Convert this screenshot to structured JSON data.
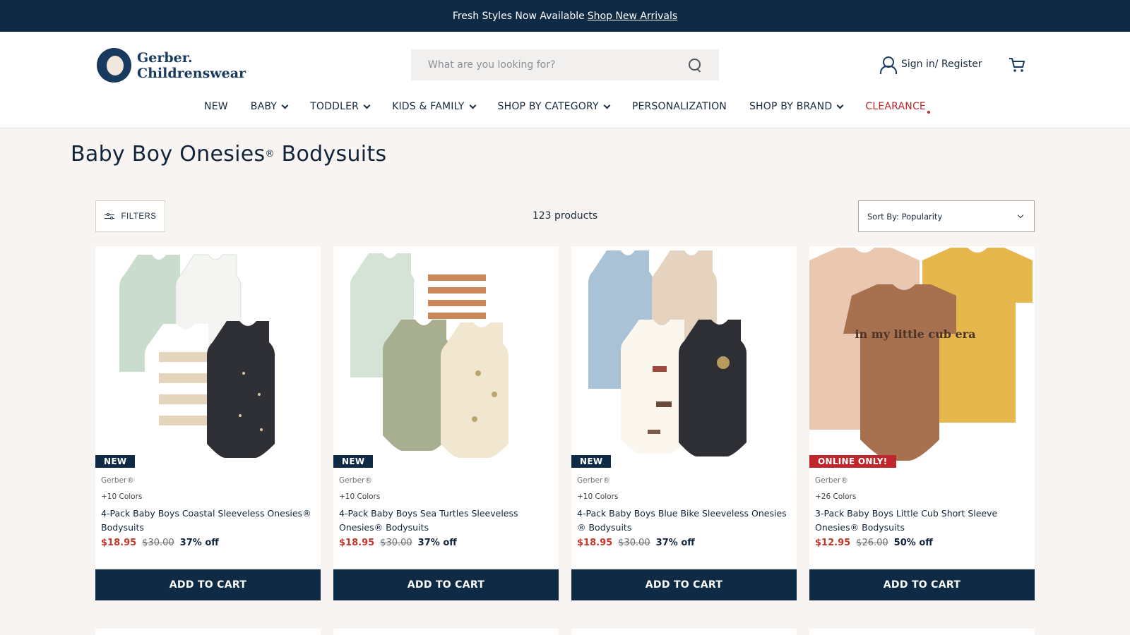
{
  "promo": {
    "text": "Fresh Styles Now Available",
    "link": "Shop New Arrivals"
  },
  "header": {
    "logo_line1": "Gerber.",
    "logo_line2": "Childrenswear",
    "search_placeholder": "What are you looking for?",
    "account_label": "Sign in/ Register"
  },
  "nav": [
    {
      "label": "NEW",
      "has_menu": false
    },
    {
      "label": "BABY",
      "has_menu": true
    },
    {
      "label": "TODDLER",
      "has_menu": true
    },
    {
      "label": "KIDS & FAMILY",
      "has_menu": true
    },
    {
      "label": "SHOP BY CATEGORY",
      "has_menu": true
    },
    {
      "label": "PERSONALIZATION",
      "has_menu": false
    },
    {
      "label": "SHOP BY BRAND",
      "has_menu": true
    },
    {
      "label": "CLEARANCE",
      "has_menu": false
    }
  ],
  "page": {
    "title_part1": "Baby Boy Onesies",
    "title_reg": "®",
    "title_part2": " Bodysuits",
    "filters_label": "FILTERS",
    "product_count": "123 products",
    "sort_label": "Sort By: Popularity"
  },
  "products": [
    {
      "badge": "NEW",
      "brand": "Gerber®",
      "colors": "+10 Colors",
      "name": "4-Pack Baby Boys Coastal Sleeveless Onesies® Bodysuits",
      "price": "$18.95",
      "old_price": "$30.00",
      "off": "37% off",
      "cta": "ADD TO CART"
    },
    {
      "badge": "NEW",
      "brand": "Gerber®",
      "colors": "+10 Colors",
      "name": "4-Pack Baby Boys Sea Turtles Sleeveless Onesies® Bodysuits",
      "price": "$18.95",
      "old_price": "$30.00",
      "off": "37% off",
      "cta": "ADD TO CART"
    },
    {
      "badge": "NEW",
      "brand": "Gerber®",
      "colors": "+10 Colors",
      "name": "4-Pack Baby Boys Blue Bike Sleeveless Onesies ® Bodysuits",
      "price": "$18.95",
      "old_price": "$30.00",
      "off": "37% off",
      "cta": "ADD TO CART"
    },
    {
      "badge": "ONLINE ONLY!",
      "brand": "Gerber®",
      "colors": "+26 Colors",
      "name": "3-Pack Baby Boys Little Cub Short Sleeve Onesies® Bodysuits",
      "price": "$12.95",
      "old_price": "$26.00",
      "off": "50% off",
      "cta": "ADD TO CART"
    }
  ],
  "product_image_print": "in my little cub era",
  "colors": {
    "navy": "#0e2a45",
    "sale_red": "#c0392b",
    "clearance_red": "#c0272d",
    "background": "#f7f4f1"
  }
}
